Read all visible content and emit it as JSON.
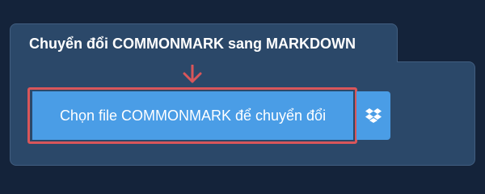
{
  "tab": {
    "title": "Chuyển đổi COMMONMARK sang MARKDOWN"
  },
  "upload": {
    "button_label": "Chọn file COMMONMARK để chuyển đổi",
    "dropbox_icon": "dropbox-icon",
    "arrow_icon": "arrow-down-icon"
  },
  "colors": {
    "page_background": "#14233a",
    "panel_background": "#2b4869",
    "button_background": "#4a9de6",
    "highlight_border": "#d9565a"
  }
}
